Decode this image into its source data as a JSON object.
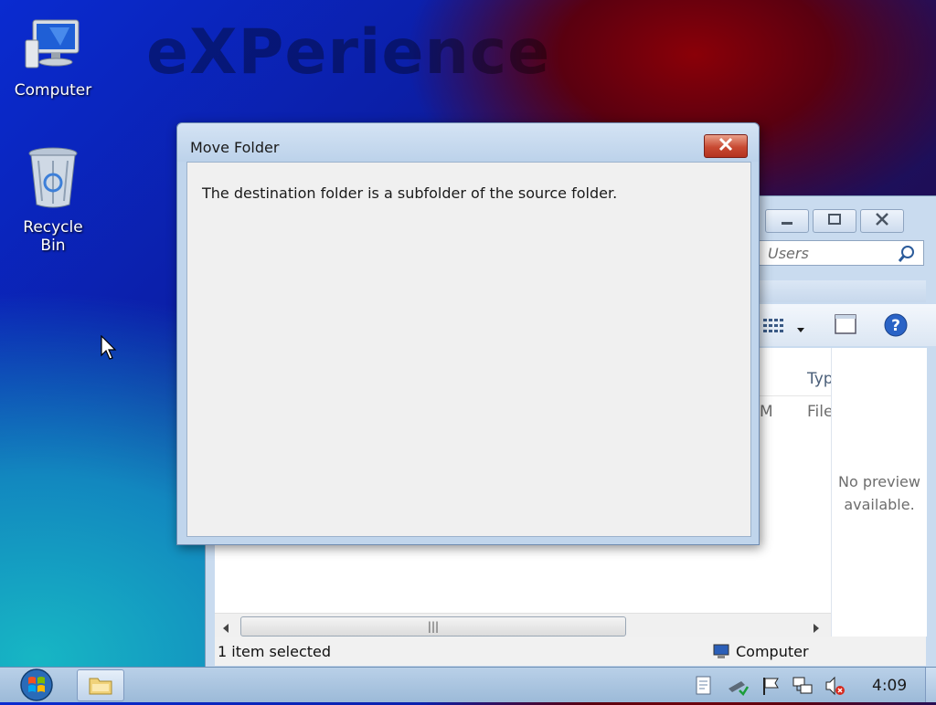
{
  "desktop": {
    "watermark": "eXPerience",
    "icons": [
      {
        "label": "Computer",
        "icon": "computer-icon"
      },
      {
        "label": "Recycle Bin",
        "icon": "recycle-bin-icon"
      }
    ]
  },
  "explorer": {
    "search_placeholder": "Users",
    "column_header_type": "Typ",
    "row_date_fragment": "M",
    "row_type_fragment": "File",
    "preview_text_line1": "No preview",
    "preview_text_line2": "available.",
    "status_left": "1 item selected",
    "status_right": "Computer",
    "buttons": [
      "minimize",
      "maximize",
      "close"
    ]
  },
  "dialog": {
    "title": "Move Folder",
    "message": "The destination folder is a subfolder of the source folder."
  },
  "taskbar": {
    "clock": "4:09",
    "tray_icons": [
      "notes-icon",
      "network-tool-icon",
      "action-center-flag-icon",
      "network-icon",
      "volume-muted-icon"
    ]
  },
  "colors": {
    "dialog_frame": "#c0d5ec",
    "close_button": "#c84a33",
    "taskbar": "#b9d0e8"
  }
}
